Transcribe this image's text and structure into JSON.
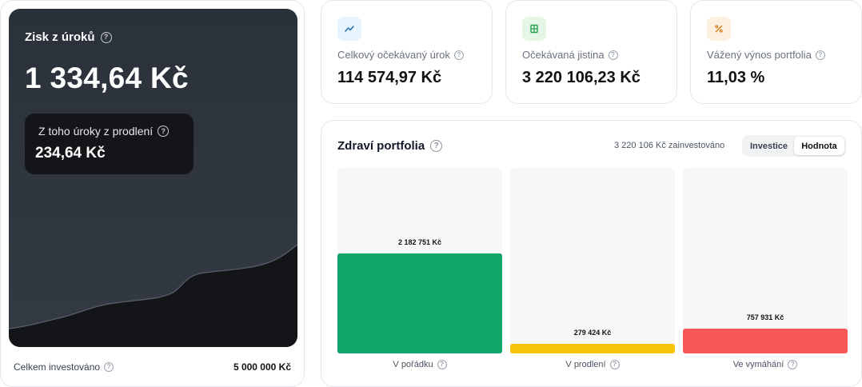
{
  "summary": {
    "title": "Zisk z úroků",
    "value": "1 334,64 Kč",
    "late_label": "Z toho úroky z prodlení",
    "late_value": "234,64 Kč",
    "total_label": "Celkem investováno",
    "total_value": "5 000 000 Kč"
  },
  "stats": [
    {
      "label": "Celkový očekávaný úrok",
      "value": "114 574,97 Kč",
      "icon": "trend-up-icon",
      "icon_bg": "#e5f4fe",
      "icon_color": "#1e6fb0"
    },
    {
      "label": "Očekávaná jistina",
      "value": "3 220 106,23 Kč",
      "icon": "cash-icon",
      "icon_bg": "#e3f6e7",
      "icon_color": "#20a04a"
    },
    {
      "label": "Vážený výnos portfolia",
      "value": "11,03 %",
      "icon": "percent-icon",
      "icon_bg": "#fdf0e0",
      "icon_color": "#d77a16"
    }
  ],
  "health": {
    "title": "Zdraví portfolia",
    "invested_note": "3 220 106 Kč zainvestováno",
    "toggle": {
      "options": [
        "Investice",
        "Hodnota"
      ],
      "active": "Hodnota"
    },
    "columns": [
      {
        "label": "V pořádku",
        "value_text": "2 182 751 Kč",
        "fill": 0.54,
        "color": "#10a56a"
      },
      {
        "label": "V prodlení",
        "value_text": "279 424 Kč",
        "fill": 0.05,
        "color": "#f7c309"
      },
      {
        "label": "Ve vymáhání",
        "value_text": "757 931 Kč",
        "fill": 0.135,
        "color": "#f75757"
      }
    ]
  }
}
